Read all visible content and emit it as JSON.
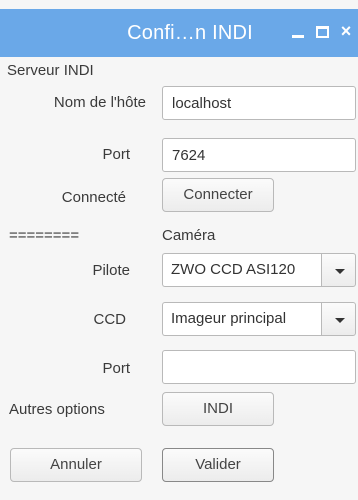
{
  "window": {
    "title": "Confi…n INDI",
    "minimize_icon": "minimize-icon",
    "maximize_icon": "maximize-icon",
    "close_icon": "close-icon",
    "close_glyph": "×"
  },
  "server": {
    "section_label": "Serveur INDI",
    "host_label": "Nom de l'hôte",
    "host_value": "localhost",
    "port_label": "Port",
    "port_value": "7624",
    "connected_label": "Connecté",
    "connect_button": "Connecter"
  },
  "camera": {
    "separator": "========",
    "section_label": "Caméra",
    "driver_label": "Pilote",
    "driver_value": "ZWO CCD ASI120",
    "ccd_label": "CCD",
    "ccd_value": "Imageur principal",
    "port_label": "Port",
    "port_value": ""
  },
  "other": {
    "label": "Autres options",
    "indi_button": "INDI"
  },
  "footer": {
    "cancel_button": "Annuler",
    "ok_button": "Valider"
  }
}
